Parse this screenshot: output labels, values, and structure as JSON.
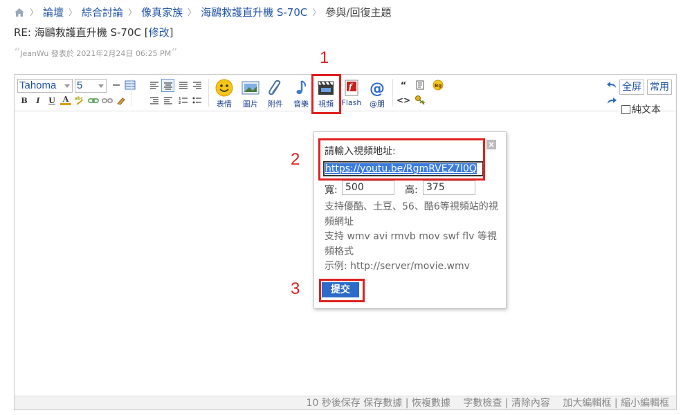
{
  "breadcrumb": {
    "items": [
      "論壇",
      "綜合討論",
      "像真家族",
      "海鷗救護直升機 S-70C"
    ],
    "current": "參與/回復主題"
  },
  "post": {
    "title": "RE: 海鷗救護直升機 S-70C",
    "edit_open": "[",
    "edit_link": "修改",
    "edit_close": "]",
    "author_line": "JeanWu 發表於 2021年2月24日 06:25 PM"
  },
  "toolbar": {
    "font": "Tahoma",
    "size": "5",
    "buttons": [
      "表情",
      "圖片",
      "附件",
      "音樂",
      "視頻",
      "Flash",
      "@朋"
    ],
    "fullscreen": "全屏",
    "common": "常用",
    "plain_text": "純文本"
  },
  "popup": {
    "prompt": "請輸入視頻地址:",
    "url_value": "https://youtu.be/RgmRVEZ7l0Q",
    "width_label": "寬:",
    "width_value": "500",
    "height_label": "高:",
    "height_value": "375",
    "help_1": "支持優酷、土豆、56、酷6等視頻站的視頻網址",
    "help_2": "支持 wmv avi rmvb mov swf flv 等視頻格式",
    "help_3": "示例: http://server/movie.wmv",
    "submit": "提交"
  },
  "statusbar": {
    "text": "10 秒後保存 保存數據 | 恢複數據　 字數檢查 | 清除內容　 加大編輯框 | 縮小編輯框"
  },
  "annotations": [
    "1",
    "2",
    "3"
  ],
  "colors": {
    "link": "#2254a5",
    "annotation": "#e02020",
    "submit": "#2c6bc9",
    "selection": "#3a7be0"
  }
}
